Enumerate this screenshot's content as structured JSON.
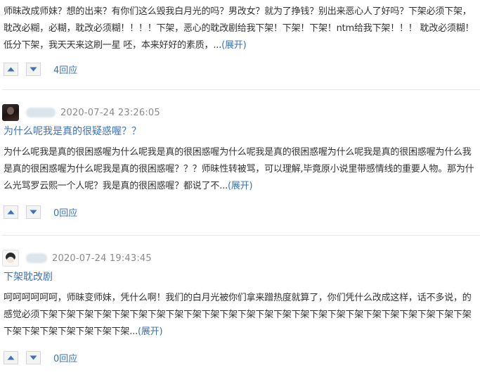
{
  "comments": [
    {
      "text": "师昧改成师妹？想的出来？有你们这么毁我白月光的吗？男改女？就为了挣钱？别出来恶心人了好吗？下架必须下架，耽改必糊，必糊，耽改必须糊！！！！下架，恶心的耽改剧给我下架！下架！下架！ntm给我下架！！！ 耽改必须糊！低分下架，我天天来这刷一星 呸，本来好好的素质，...",
      "expand_label": "(展开)",
      "replies": "4回应"
    },
    {
      "timestamp": "2020-07-24 23:26:05",
      "title": "为什么呢我是真的很疑惑喔？？",
      "text": "为什么呢我是真的很困惑喔为什么呢我是真的很困惑喔为什么呢我是真的很困惑喔为什么呢我是真的很困惑喔为什么我是真的很困惑喔为什么呢我是真的很困惑喔？？？师昧性转被骂，可以理解,毕竟原小说里带感情线的重要人物。那为什么光骂罗云熙一个人呢？我是真的很困惑喔？都说了不...",
      "expand_label": "(展开)",
      "replies": "0回应"
    },
    {
      "timestamp": "2020-07-24 19:43:45",
      "title": "下架耽改剧",
      "text": "呵呵呵呵呵呵，师昧变师妹，凭什么啊！我们的白月光被你们拿来蹭热度就算了，你们凭什么改成这样，话不多说，的感觉必须下架下架下架下架下架下架下架下架下架下架下架下架下架下架下架下架下架下架下架下架下架下架下架下架下架下架下架下架下架下架下架...",
      "expand_label": "(展开)",
      "replies": "0回应"
    }
  ],
  "icons": {
    "upvote": "triangle-up-icon",
    "downvote": "triangle-down-icon"
  },
  "colors": {
    "link": "#3b72b8",
    "text": "#333333",
    "meta": "#8a8a8a",
    "button_bg": "#f2f4f6"
  }
}
